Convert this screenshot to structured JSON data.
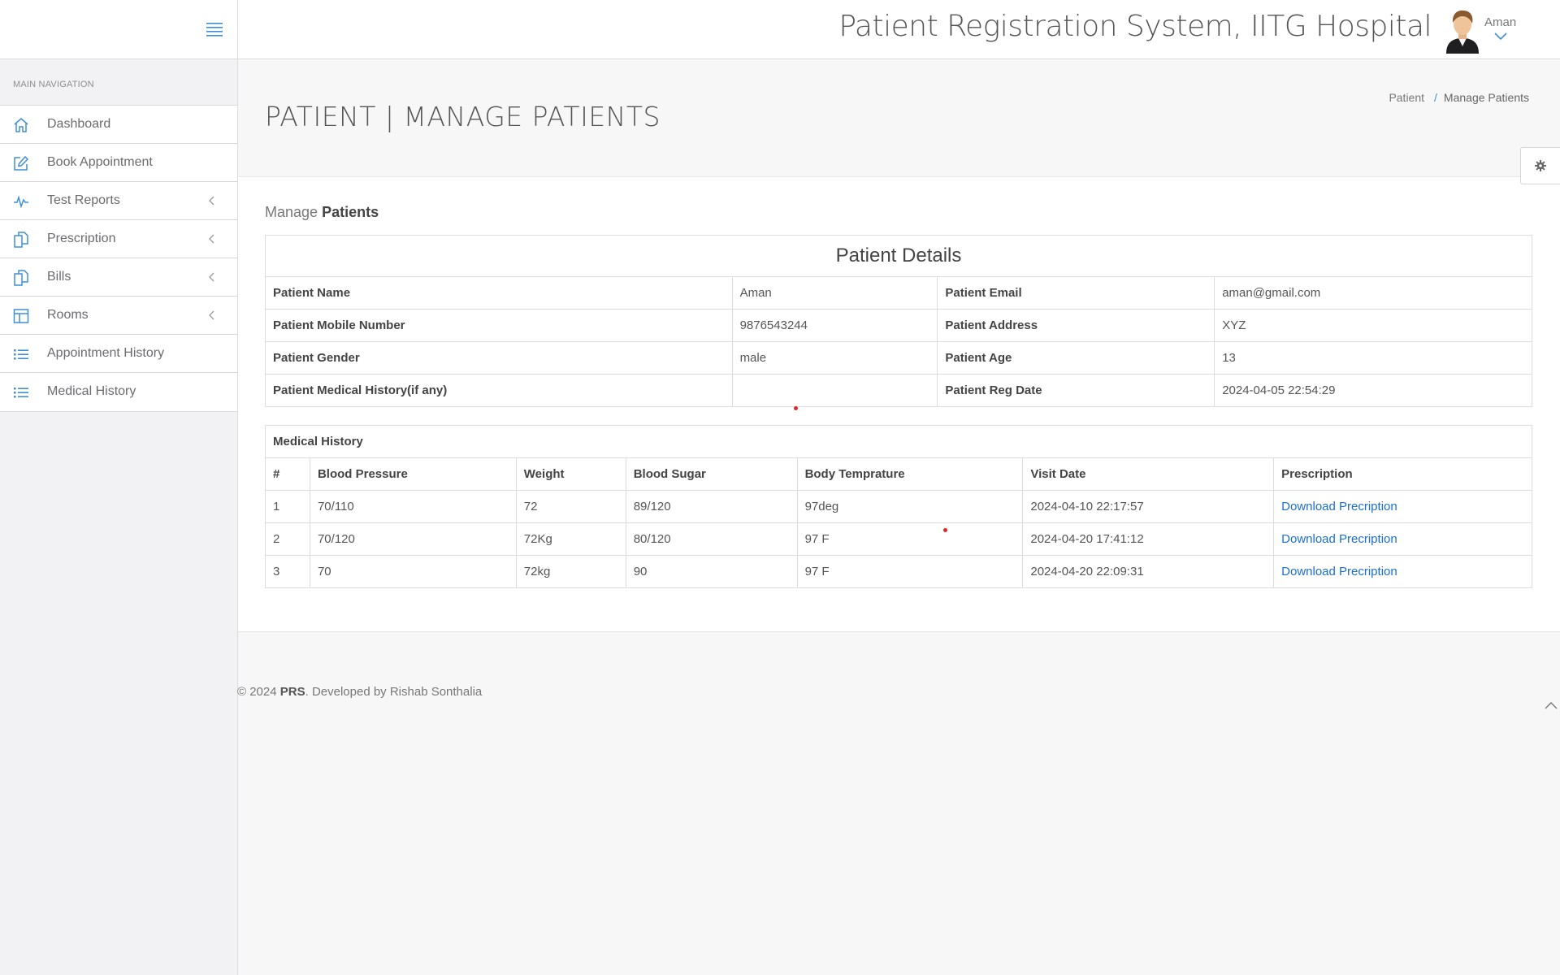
{
  "header": {
    "title": "Patient Registration System, IITG Hospital",
    "user_name": "Aman",
    "menu_icon": "hamburger-icon",
    "accent_color": "#3f8fd6"
  },
  "sidebar": {
    "heading": "MAIN NAVIGATION",
    "items": [
      {
        "label": "Dashboard",
        "icon": "home-icon",
        "has_submenu": false
      },
      {
        "label": "Book Appointment",
        "icon": "edit-icon",
        "has_submenu": false
      },
      {
        "label": "Test Reports",
        "icon": "pulse-icon",
        "has_submenu": true
      },
      {
        "label": "Prescription",
        "icon": "documents-icon",
        "has_submenu": true
      },
      {
        "label": "Bills",
        "icon": "documents-icon",
        "has_submenu": true
      },
      {
        "label": "Rooms",
        "icon": "layout-icon",
        "has_submenu": true
      },
      {
        "label": "Appointment History",
        "icon": "list-icon",
        "has_submenu": false
      },
      {
        "label": "Medical History",
        "icon": "list-icon",
        "has_submenu": false
      }
    ]
  },
  "page": {
    "title": "PATIENT | MANAGE PATIENTS",
    "breadcrumb": [
      "Patient",
      "/",
      "Manage Patients"
    ]
  },
  "panel": {
    "heading_prefix": "Manage",
    "heading_bold": "Patients"
  },
  "details": {
    "caption": "Patient Details",
    "rows": [
      {
        "label1": "Patient Name",
        "value1": "Aman",
        "label2": "Patient Email",
        "value2": "aman@gmail.com"
      },
      {
        "label1": "Patient Mobile Number",
        "value1": "9876543244",
        "label2": "Patient Address",
        "value2": "XYZ"
      },
      {
        "label1": "Patient Gender",
        "value1": "male",
        "label2": "Patient Age",
        "value2": "13"
      },
      {
        "label1": "Patient Medical History(if any)",
        "value1": "",
        "label2": "Patient Reg Date",
        "value2": "2024-04-05 22:54:29"
      }
    ]
  },
  "history": {
    "caption": "Medical History",
    "columns": [
      "#",
      "Blood Pressure",
      "Weight",
      "Blood Sugar",
      "Body Temprature",
      "Visit Date",
      "Prescription"
    ],
    "rows": [
      {
        "no": "1",
        "bp": "70/110",
        "weight": "72",
        "sugar": "89/120",
        "temp": "97deg",
        "date": "2024-04-10 22:17:57",
        "link": "Download Precription"
      },
      {
        "no": "2",
        "bp": "70/120",
        "weight": "72Kg",
        "sugar": "80/120",
        "temp": "97 F",
        "date": "2024-04-20 17:41:12",
        "link": "Download Precription"
      },
      {
        "no": "3",
        "bp": "70",
        "weight": "72kg",
        "sugar": "90",
        "temp": "97 F",
        "date": "2024-04-20 22:09:31",
        "link": "Download Precription"
      }
    ]
  },
  "footer": {
    "prefix": "© 2024 ",
    "brand": "PRS",
    "suffix": ". Developed by Rishab Sonthalia"
  }
}
